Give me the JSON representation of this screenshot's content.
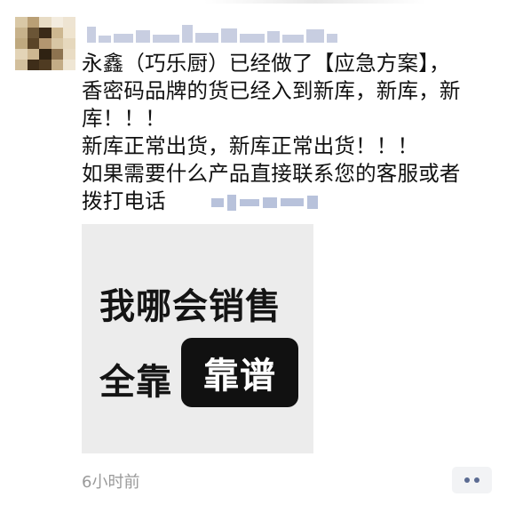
{
  "post": {
    "avatar": "avatar-pixelated",
    "author_name_redacted": true,
    "text_lines": [
      "永鑫（巧乐厨）已经做了【应急方案】，",
      "香密码品牌的货已经入到新库，新库，新",
      "库！！！",
      "新库正常出货，新库正常出货！！！",
      "如果需要什么产品直接联系您的客服或者",
      "拨打电话"
    ],
    "phone_redacted": true,
    "image": {
      "line1": "我哪会销售",
      "line2": "全靠",
      "overlay": "靠谱"
    },
    "timestamp": "6小时前",
    "more_icon": "ellipsis-icon"
  },
  "colors": {
    "link_blue": "#5b6b92",
    "timestamp_gray": "#9a9a9a",
    "text": "#111111"
  }
}
